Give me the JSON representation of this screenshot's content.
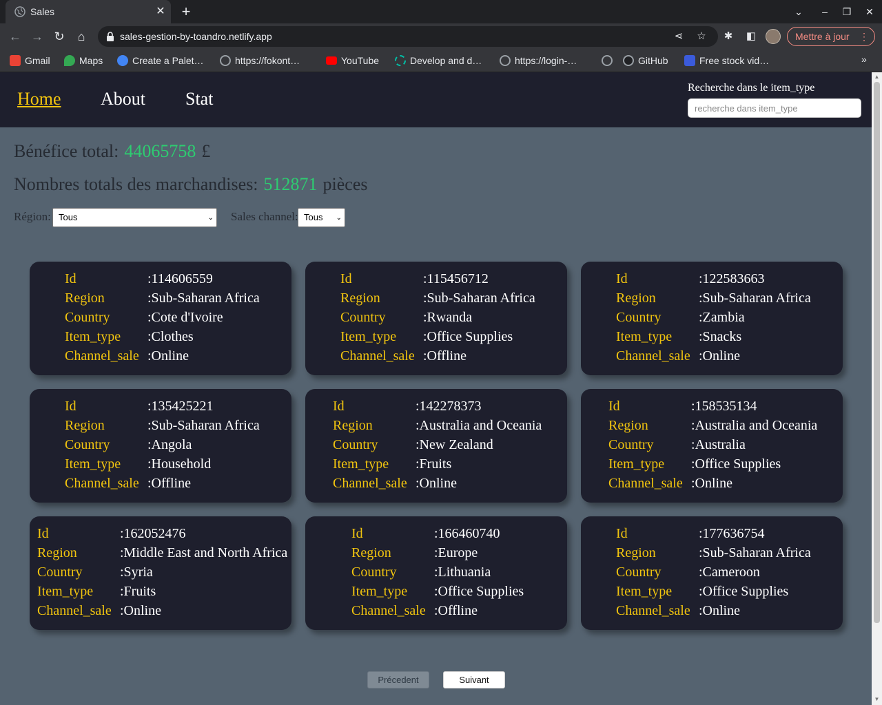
{
  "browser": {
    "tab_title": "Sales",
    "tab_close": "✕",
    "new_tab": "+",
    "url": "sales-gestion-by-toandro.netlify.app",
    "update_label": "Mettre à jour",
    "bookmarks": [
      {
        "label": "Gmail",
        "icon": "gmail-icon",
        "color": "#ea4335"
      },
      {
        "label": "Maps",
        "icon": "maps-icon",
        "color": "#34a853"
      },
      {
        "label": "Create a Palet…",
        "icon": "palette-icon",
        "color": "#4285f4"
      },
      {
        "label": "https://fokont…",
        "icon": "globe-icon",
        "color": "#9aa0a6"
      },
      {
        "label": "YouTube",
        "icon": "youtube-icon",
        "color": "#ff0000"
      },
      {
        "label": "Develop and d…",
        "icon": "develop-icon",
        "color": "#00c2a8"
      },
      {
        "label": "https://login-…",
        "icon": "globe-icon",
        "color": "#9aa0a6"
      },
      {
        "label": "",
        "icon": "globe-icon",
        "color": "#9aa0a6"
      },
      {
        "label": "GitHub",
        "icon": "github-icon",
        "color": "#ffffff"
      },
      {
        "label": "Free stock vid…",
        "icon": "stock-video-icon",
        "color": "#3b5bdb"
      }
    ],
    "bookmarks_more": "»"
  },
  "navbar": {
    "links": [
      "Home",
      "About",
      "Stat"
    ],
    "active": "Home",
    "search_label": "Recherche dans le item_type",
    "search_placeholder": "recherche dans item_type"
  },
  "summary": {
    "profit_label": "Bénéfice total:",
    "profit_value": "44065758",
    "profit_unit": "£",
    "goods_label": "Nombres totals des marchandises:",
    "goods_value": "512871",
    "goods_unit": "pièces"
  },
  "filters": {
    "region_label": "Région:",
    "region_value": "Tous",
    "channel_label": "Sales channel:",
    "channel_value": "Tous"
  },
  "card_keys": [
    "Id",
    "Region",
    "Country",
    "Item_type",
    "Channel_sale"
  ],
  "cards": [
    {
      "id": ":114606559",
      "region": ":Sub-Saharan Africa",
      "country": ":Cote d'Ivoire",
      "item_type": ":Clothes",
      "channel": ":Online"
    },
    {
      "id": ":115456712",
      "region": ":Sub-Saharan Africa",
      "country": ":Rwanda",
      "item_type": ":Office Supplies",
      "channel": ":Offline"
    },
    {
      "id": ":122583663",
      "region": ":Sub-Saharan Africa",
      "country": ":Zambia",
      "item_type": ":Snacks",
      "channel": ":Online"
    },
    {
      "id": ":135425221",
      "region": ":Sub-Saharan Africa",
      "country": ":Angola",
      "item_type": ":Household",
      "channel": ":Offline"
    },
    {
      "id": ":142278373",
      "region": ":Australia and Oceania",
      "country": ":New Zealand",
      "item_type": ":Fruits",
      "channel": ":Online"
    },
    {
      "id": ":158535134",
      "region": ":Australia and Oceania",
      "country": ":Australia",
      "item_type": ":Office Supplies",
      "channel": ":Online"
    },
    {
      "id": ":162052476",
      "region": ":Middle East and North Africa",
      "country": ":Syria",
      "item_type": ":Fruits",
      "channel": ":Online"
    },
    {
      "id": ":166460740",
      "region": ":Europe",
      "country": ":Lithuania",
      "item_type": ":Office Supplies",
      "channel": ":Offline"
    },
    {
      "id": ":177636754",
      "region": ":Sub-Saharan Africa",
      "country": ":Cameroon",
      "item_type": ":Office Supplies",
      "channel": ":Online"
    }
  ],
  "pagination": {
    "prev_label": "Précedent",
    "next_label": "Suivant"
  },
  "colors": {
    "page_bg": "#556370",
    "card_bg": "#1e1f2d",
    "accent_yellow": "#f1c40f",
    "value_green": "#2ecc71"
  }
}
